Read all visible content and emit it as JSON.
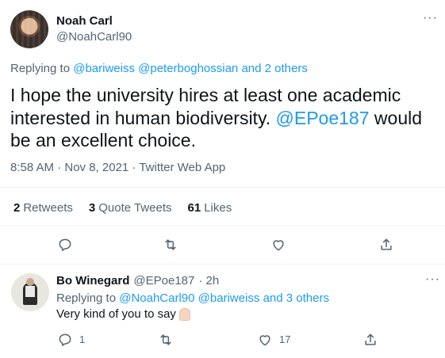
{
  "main_tweet": {
    "author_name": "Noah Carl",
    "author_handle": "@NoahCarl90",
    "more": "···",
    "replying_to_prefix": "Replying to ",
    "replying_to_mentions": "@bariweiss @peterboghossian",
    "replying_to_suffix_text": " and ",
    "replying_to_others": "2 others",
    "text_part1": "I hope the university hires at least one academic interested in human biodiversity. ",
    "text_mention": "@EPoe187",
    "text_part2": " would be an excellent choice.",
    "timestamp": "8:58 AM · Nov 8, 2021 · ",
    "source": "Twitter Web App",
    "stats": {
      "retweets_count": "2",
      "retweets_label": "Retweets",
      "quotes_count": "3",
      "quotes_label": "Quote Tweets",
      "likes_count": "61",
      "likes_label": "Likes"
    },
    "actions": {
      "reply_icon": "reply-icon",
      "retweet_icon": "retweet-icon",
      "like_icon": "heart-icon",
      "share_icon": "share-icon"
    }
  },
  "reply_tweet": {
    "author_name": "Bo Winegard",
    "author_handle": "@EPoe187",
    "time": "· 2h",
    "more": "···",
    "replying_to_prefix": "Replying to ",
    "replying_to_mentions": "@NoahCarl90 @bariweiss",
    "replying_to_suffix_text": " and ",
    "replying_to_others": "3 others",
    "text": "Very kind of you to say",
    "emoji_icon": "folded-hands-icon",
    "reply_count": "1",
    "like_count": "17"
  },
  "colors": {
    "accent": "#1d9bf0",
    "text": "#0f1419",
    "secondary": "#536471",
    "divider": "#eff3f4"
  }
}
